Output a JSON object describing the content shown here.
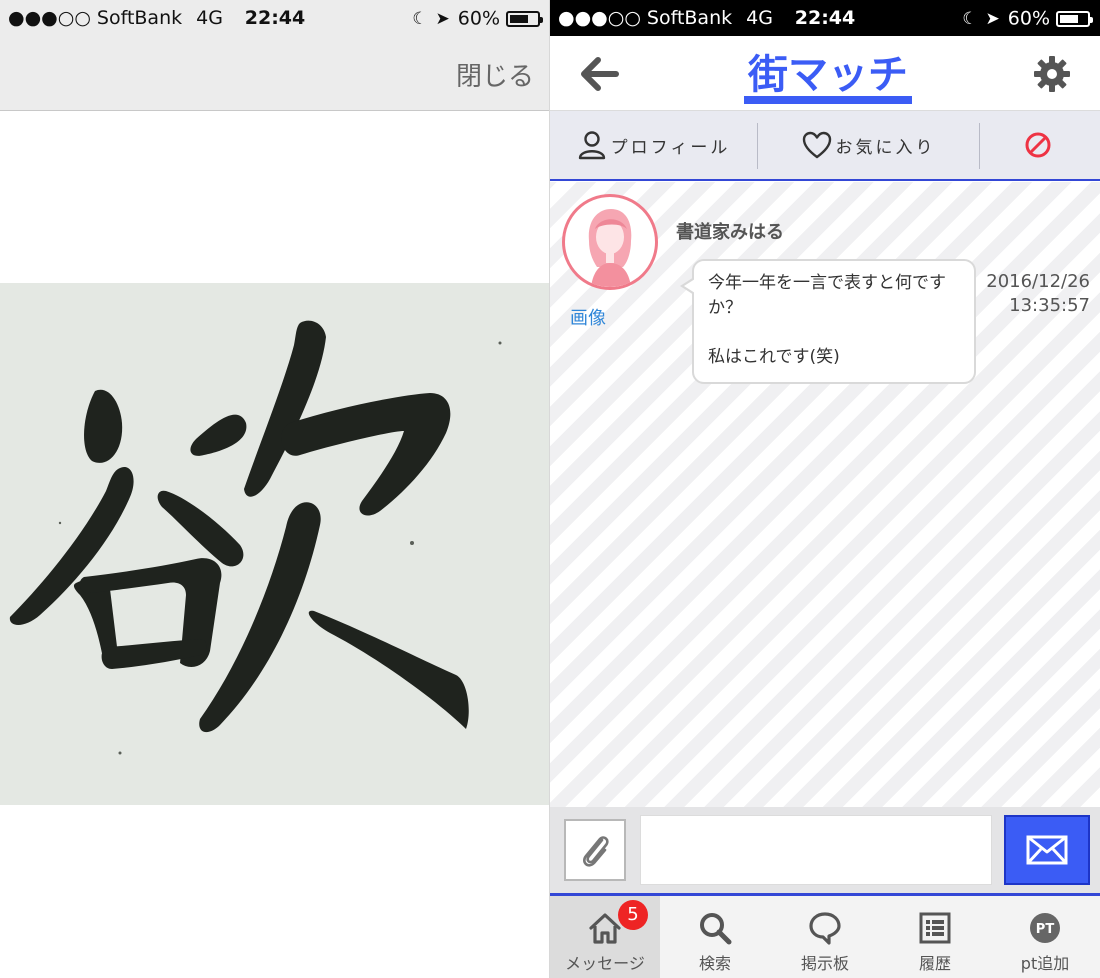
{
  "left_pane": {
    "status_bar": {
      "signal": "●●●○○",
      "carrier": "SoftBank",
      "network": "4G",
      "time": "22:44",
      "battery": "60%",
      "battery_level": 0.6
    },
    "close_label": "閉じる",
    "image_character": "欲"
  },
  "right_pane": {
    "status_bar": {
      "signal": "●●●○○",
      "carrier": "SoftBank",
      "network": "4G",
      "time": "22:44",
      "battery": "60%",
      "battery_level": 0.6
    },
    "header": {
      "logo_text": "街マッチ",
      "back_icon": "arrow-left-icon",
      "settings_icon": "gear-icon"
    },
    "tabs": [
      {
        "label": "プロフィール",
        "icon": "user-icon"
      },
      {
        "label": "お気に入り",
        "icon": "heart-icon"
      },
      {
        "label": "",
        "icon": "block-icon"
      }
    ],
    "message": {
      "sender": "書道家みはる",
      "image_link": "画像",
      "text": "今年一年を一言で表すと何ですか？\n\n私はこれです(笑)",
      "date": "2016/12/26",
      "time": "13:35:57"
    },
    "input": {
      "placeholder": "",
      "value": ""
    },
    "nav": [
      {
        "label": "メッセージ",
        "icon": "home-icon",
        "badge": "5"
      },
      {
        "label": "検索",
        "icon": "search-icon"
      },
      {
        "label": "掲示板",
        "icon": "speech-bubble-icon"
      },
      {
        "label": "履歴",
        "icon": "list-icon"
      },
      {
        "label": "pt追加",
        "icon": "pt-icon"
      }
    ],
    "colors": {
      "accent": "#3347d6",
      "send": "#3b5cf5",
      "badge": "#ee2424",
      "block": "#ee3344",
      "link": "#2f86d8"
    }
  }
}
